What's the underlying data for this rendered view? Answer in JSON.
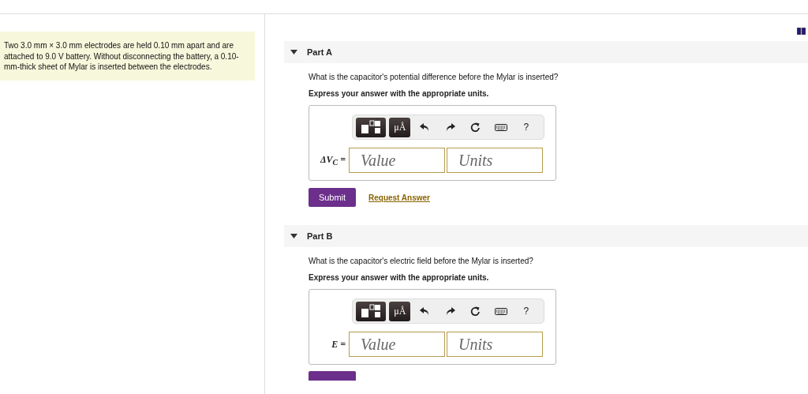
{
  "problem": {
    "text": "Two 3.0 mm × 3.0 mm electrodes are held 0.10 mm apart and are attached to 9.0 V battery. Without disconnecting the battery, a 0.10-mm-thick sheet of Mylar is inserted between the electrodes."
  },
  "parts": [
    {
      "title": "Part A",
      "expanded": true,
      "question": "What is the capacitor's potential difference before the Mylar is inserted?",
      "instruction": "Express your answer with the appropriate units.",
      "units_button": "μÅ",
      "help": "?",
      "label": "ΔV$_{C}$ =",
      "value_placeholder": "Value",
      "units_placeholder": "Units",
      "submit": "Submit",
      "request": "Request Answer"
    },
    {
      "title": "Part B",
      "expanded": true,
      "question": "What is the capacitor's electric field before the Mylar is inserted?",
      "instruction": "Express your answer with the appropriate units.",
      "units_button": "μÅ",
      "help": "?",
      "label": "E =",
      "value_placeholder": "Value",
      "units_placeholder": "Units"
    }
  ]
}
